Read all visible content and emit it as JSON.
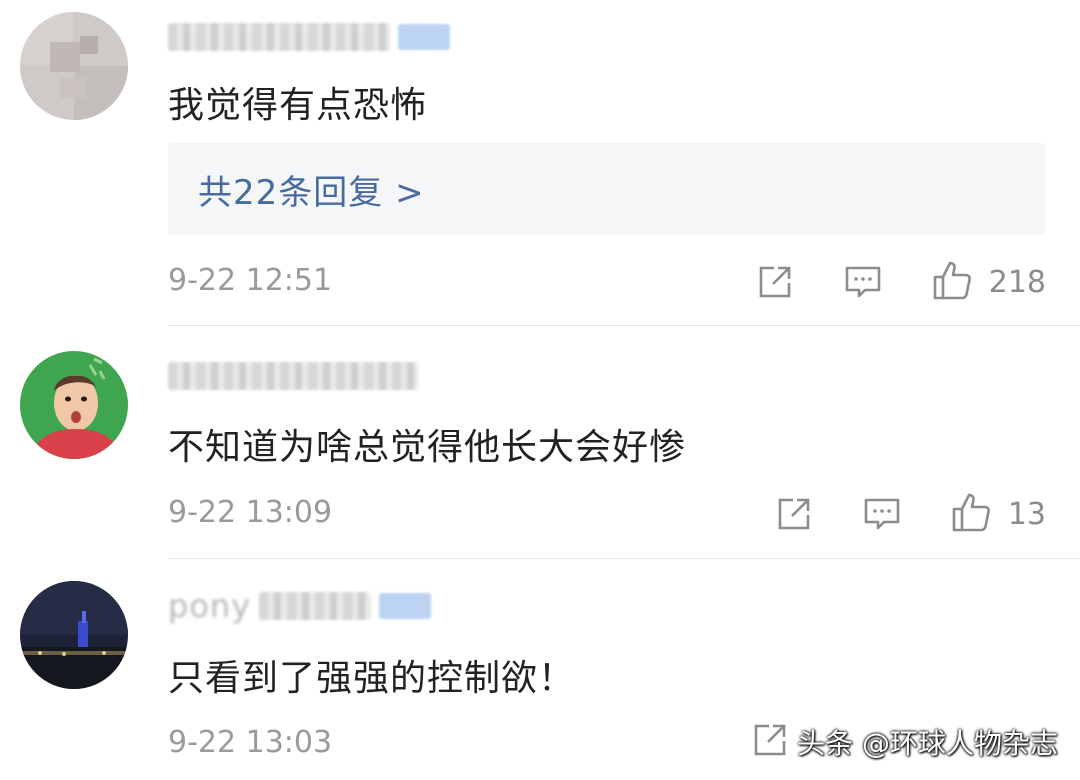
{
  "comments": [
    {
      "content": "我觉得有点恐怖",
      "replies_label": "共22条回复 >",
      "time": "9-22 12:51",
      "likes": "218"
    },
    {
      "content": "不知道为啥总觉得他长大会好惨",
      "time": "9-22 13:09",
      "likes": "13"
    },
    {
      "username_visible": "pony",
      "content": "只看到了强强的控制欲！",
      "time": "9-22 13:03"
    }
  ],
  "icons": {
    "share": "share-icon",
    "reply": "comment-icon",
    "like": "thumbs-up-icon"
  },
  "watermark": "头条 @环球人物杂志",
  "colors": {
    "link": "#476b9d",
    "text": "#222222",
    "meta": "#9a9a9a",
    "reply_bg": "#f5f6f8",
    "badge": "#bcd4f2"
  }
}
